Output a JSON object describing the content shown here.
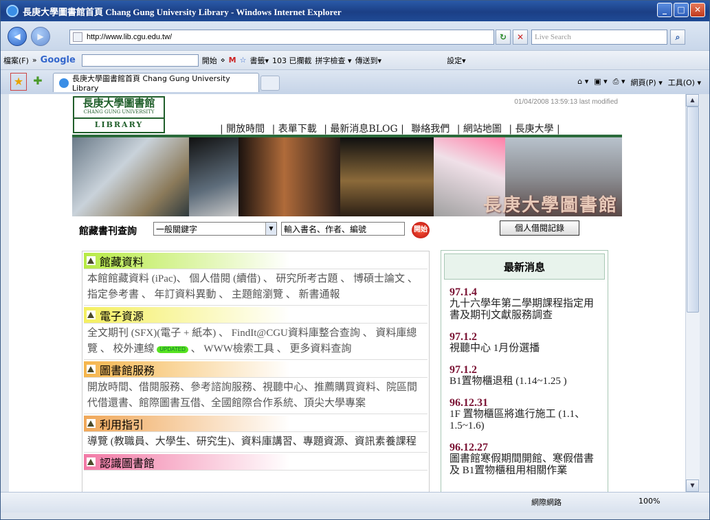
{
  "window": {
    "title": "長庚大學圖書館首頁 Chang Gung University Library - Windows Internet Explorer",
    "min_label": "_",
    "max_label": "□",
    "close_label": "✕"
  },
  "address": {
    "url": "http://www.lib.cgu.edu.tw/",
    "search_placeholder": "Live Search"
  },
  "google_bar": {
    "items": [
      "檔案(F)",
      "»",
      "Google",
      "開始",
      "⋄",
      "書籤▾",
      "103 已攔截",
      "拼字檢查 ▾",
      "傳送到▾",
      "設定▾"
    ]
  },
  "tab": {
    "label": "長庚大學圖書館首頁 Chang Gung University Library",
    "cmd_items": [
      "網頁(P) ▾",
      "工具(O) ▾"
    ]
  },
  "status": {
    "zone": "網際網路",
    "zoom": "100%"
  },
  "page": {
    "logo": {
      "cn": "長庚大學圖書館",
      "en": "CHANG GUNG UNIVERSITY",
      "lib": "LIBRARY"
    },
    "modified": "01/04/2008 13:59:13 last modified",
    "topnav": [
      "| 開放時間",
      "| 表單下載",
      "| 最新消息BLOG |",
      "聯絡我們",
      "| 網站地圖",
      "| 長庚大學 |"
    ],
    "banner_text": "長庚大學圖書館",
    "search": {
      "label": "館藏書刊查詢",
      "dropdown": "一般關鍵字",
      "keyword": "輸入書名、作者、編號",
      "go": "開始",
      "record": "個人借閱記錄"
    },
    "sections": [
      {
        "title": "館藏資料",
        "color": "#b7ea45",
        "body": "本館館藏資料 (iPac)、 個人借閱 (續借) 、 研究所考古題 、 博碩士論文 、 指定參考書 、 年訂資料異動 、 主題館瀏覽 、 新書通報"
      },
      {
        "title": "電子資源",
        "color": "#f4ef60",
        "body": "全文期刊 (SFX)(電子 + 紙本) 、 FindIt@CGU資料庫整合查詢 、 資料庫總覽 、 校外連線",
        "badge": "UPDATED",
        "body2": " 、 WWW檢索工具 、 更多資料查詢"
      },
      {
        "title": "圖書館服務",
        "color": "#f5b54c",
        "body": "開放時間、借閱服務、參考諮詢服務、視聽中心、推薦購買資料、院區間代借還書、館際圖書互借、全國館際合作系統、頂尖大學專案"
      },
      {
        "title": "利用指引",
        "color": "#f0a85a",
        "body": "導覽 (教職員、大學生、研究生)、資料庫講習、專題資源、資訊素養課程"
      },
      {
        "title": "認識圖書館",
        "color": "#f27aa6",
        "body": ""
      }
    ],
    "news_title": "最新消息",
    "news": [
      {
        "date": "97.1.4",
        "text": "九十六學年第二學期課程指定用書及期刊文獻服務調查"
      },
      {
        "date": "97.1.2",
        "text": "視聽中心 1月份選播"
      },
      {
        "date": "97.1.2",
        "text": "B1置物櫃退租 (1.14~1.25 )"
      },
      {
        "date": "96.12.31",
        "text": "1F 置物櫃區將進行施工 (1.1、1.5~1.6)"
      },
      {
        "date": "96.12.27",
        "text": "圖書館寒假期間開館、寒假借書及 B1置物櫃租用相關作業"
      }
    ]
  }
}
